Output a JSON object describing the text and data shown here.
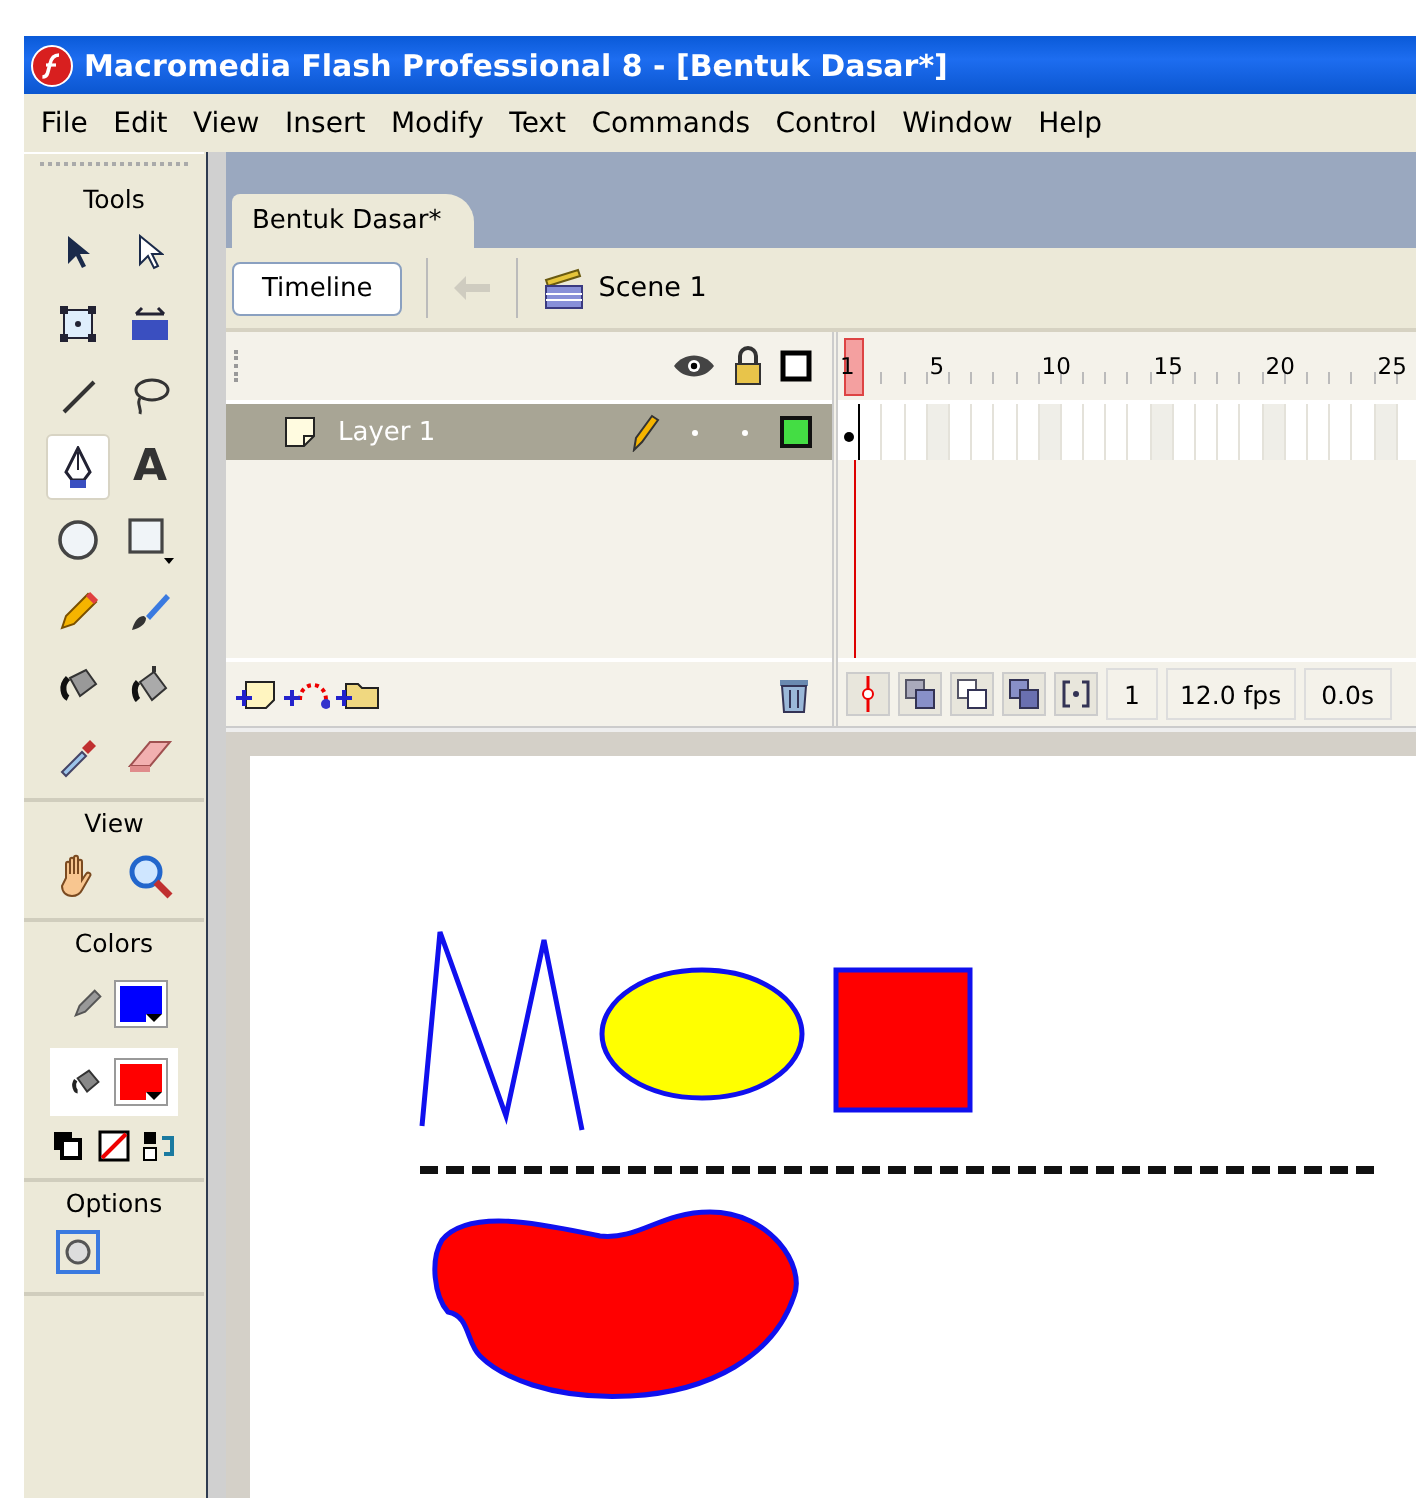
{
  "window": {
    "title": "Macromedia Flash Professional 8 - [Bentuk Dasar*]"
  },
  "menu": [
    "File",
    "Edit",
    "View",
    "Insert",
    "Modify",
    "Text",
    "Commands",
    "Control",
    "Window",
    "Help"
  ],
  "toolbox": {
    "sections": [
      {
        "title": "Tools",
        "tools": [
          {
            "kind": "arrow",
            "selected": false
          },
          {
            "kind": "subselect",
            "selected": false
          },
          {
            "kind": "transform",
            "selected": false
          },
          {
            "kind": "gradient",
            "selected": false
          },
          {
            "kind": "line",
            "selected": false
          },
          {
            "kind": "lasso",
            "selected": false
          },
          {
            "kind": "pen",
            "selected": true
          },
          {
            "kind": "text",
            "label": "A",
            "selected": false
          },
          {
            "kind": "oval",
            "selected": false
          },
          {
            "kind": "rectangle",
            "selected": false
          },
          {
            "kind": "pencil",
            "selected": false
          },
          {
            "kind": "brush",
            "selected": false
          },
          {
            "kind": "ink",
            "selected": false
          },
          {
            "kind": "bucket",
            "selected": false
          },
          {
            "kind": "dropper",
            "selected": false
          },
          {
            "kind": "eraser",
            "selected": false
          }
        ]
      },
      {
        "title": "View",
        "tools": [
          {
            "kind": "hand",
            "selected": false
          },
          {
            "kind": "zoom",
            "selected": false
          }
        ]
      },
      {
        "title": "Colors",
        "swatches": [
          {
            "kind": "stroke",
            "color": "#0000ff",
            "selected": false
          },
          {
            "kind": "fill",
            "color": "#ff0000",
            "selected": true
          }
        ],
        "tools": [
          {
            "kind": "default-colors",
            "selected": false
          },
          {
            "kind": "no-color",
            "selected": false
          },
          {
            "kind": "swap",
            "selected": false
          }
        ]
      },
      {
        "title": "Options",
        "tools": [
          {
            "kind": "snap",
            "selected": true
          }
        ]
      }
    ]
  },
  "document_tab": {
    "label": "Bentuk Dasar*",
    "selected": true
  },
  "edit_bar": {
    "timeline_button": "Timeline",
    "scene": "Scene 1"
  },
  "timeline": {
    "ruler": [
      "1",
      "5",
      "10",
      "15",
      "20",
      "25"
    ],
    "layers": [
      {
        "name": "Layer 1",
        "selected": true,
        "color": "#44dd44"
      }
    ],
    "current_frame": "1",
    "frame_rate": "12.0 fps",
    "elapsed": "0.0s"
  }
}
